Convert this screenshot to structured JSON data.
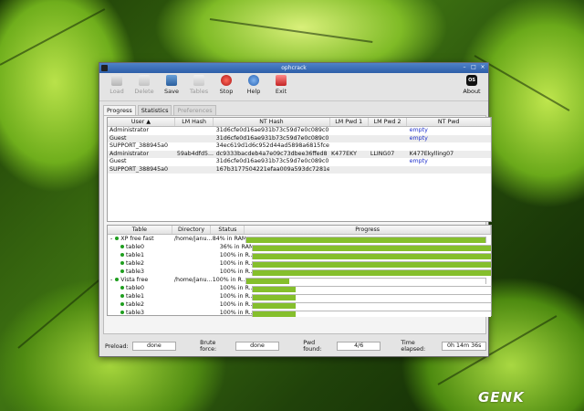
{
  "window": {
    "title": "ophcrack"
  },
  "toolbar": {
    "load": "Load",
    "delete": "Delete",
    "save": "Save",
    "tables": "Tables",
    "stop": "Stop",
    "help": "Help",
    "exit": "Exit",
    "about": "About",
    "about_badge": "OS"
  },
  "tabs": [
    "Progress",
    "Statistics",
    "Preferences"
  ],
  "users_table": {
    "headers": [
      "User",
      "LM Hash",
      "NT Hash",
      "LM Pwd 1",
      "LM Pwd 2",
      "NT Pwd"
    ],
    "rows": [
      [
        "Administrator",
        "",
        "31d6cfe0d16ae931b73c59d7e0c089c0",
        "",
        "",
        "empty"
      ],
      [
        "Guest",
        "",
        "31d6cfe0d16ae931b73c59d7e0c089c0",
        "",
        "",
        "empty"
      ],
      [
        "SUPPORT_388945a0",
        "",
        "34ec619d1d6c952d44ad5898a6815fce",
        "",
        "",
        ""
      ],
      [
        "Administrator",
        "59ab4dfd5...",
        "dc9333bacdeb4a7e09c73dbee36ffed8",
        "K477EKY",
        "LLING07",
        "K477Ekylling07"
      ],
      [
        "Guest",
        "",
        "31d6cfe0d16ae931b73c59d7e0c089c0",
        "",
        "",
        "empty"
      ],
      [
        "SUPPORT_388945a0",
        "",
        "167b3177504221efaa009a593dc7281e",
        "",
        "",
        ""
      ]
    ]
  },
  "progress_table": {
    "headers": [
      "Table",
      "Directory",
      "Status",
      "Progress"
    ],
    "rows": [
      {
        "expander": "-",
        "name": "XP free fast",
        "dir": "/home/janu...",
        "status": "84% in RAM",
        "progress": 1.0,
        "indent": 0
      },
      {
        "expander": "",
        "name": "table0",
        "dir": "",
        "status": "36% in RAM",
        "progress": 1.0,
        "indent": 1
      },
      {
        "expander": "",
        "name": "table1",
        "dir": "",
        "status": "100% in R...",
        "progress": 1.0,
        "indent": 1
      },
      {
        "expander": "",
        "name": "table2",
        "dir": "",
        "status": "100% in R...",
        "progress": 1.0,
        "indent": 1
      },
      {
        "expander": "",
        "name": "table3",
        "dir": "",
        "status": "100% in R...",
        "progress": 1.0,
        "indent": 1
      },
      {
        "expander": "-",
        "name": "Vista free",
        "dir": "/home/janu...",
        "status": "100% in R...",
        "progress": 0.18,
        "indent": 0
      },
      {
        "expander": "",
        "name": "table0",
        "dir": "",
        "status": "100% in R...",
        "progress": 0.18,
        "indent": 1
      },
      {
        "expander": "",
        "name": "table1",
        "dir": "",
        "status": "100% in R...",
        "progress": 0.18,
        "indent": 1
      },
      {
        "expander": "",
        "name": "table2",
        "dir": "",
        "status": "100% in R...",
        "progress": 0.18,
        "indent": 1
      },
      {
        "expander": "",
        "name": "table3",
        "dir": "",
        "status": "100% in R...",
        "progress": 0.18,
        "indent": 1
      }
    ]
  },
  "status_bar": {
    "preload_label": "Preload:",
    "preload_value": "done",
    "brute_label": "Brute force:",
    "brute_value": "done",
    "pwd_label": "Pwd found:",
    "pwd_value": "4/6",
    "time_label": "Time elapsed:",
    "time_value": "0h 14m 36s"
  },
  "watermark": "GENK",
  "colors": {
    "progress_fill": "#85bf2c",
    "titlebar": "#3d6fb8",
    "link": "#2233cc"
  }
}
